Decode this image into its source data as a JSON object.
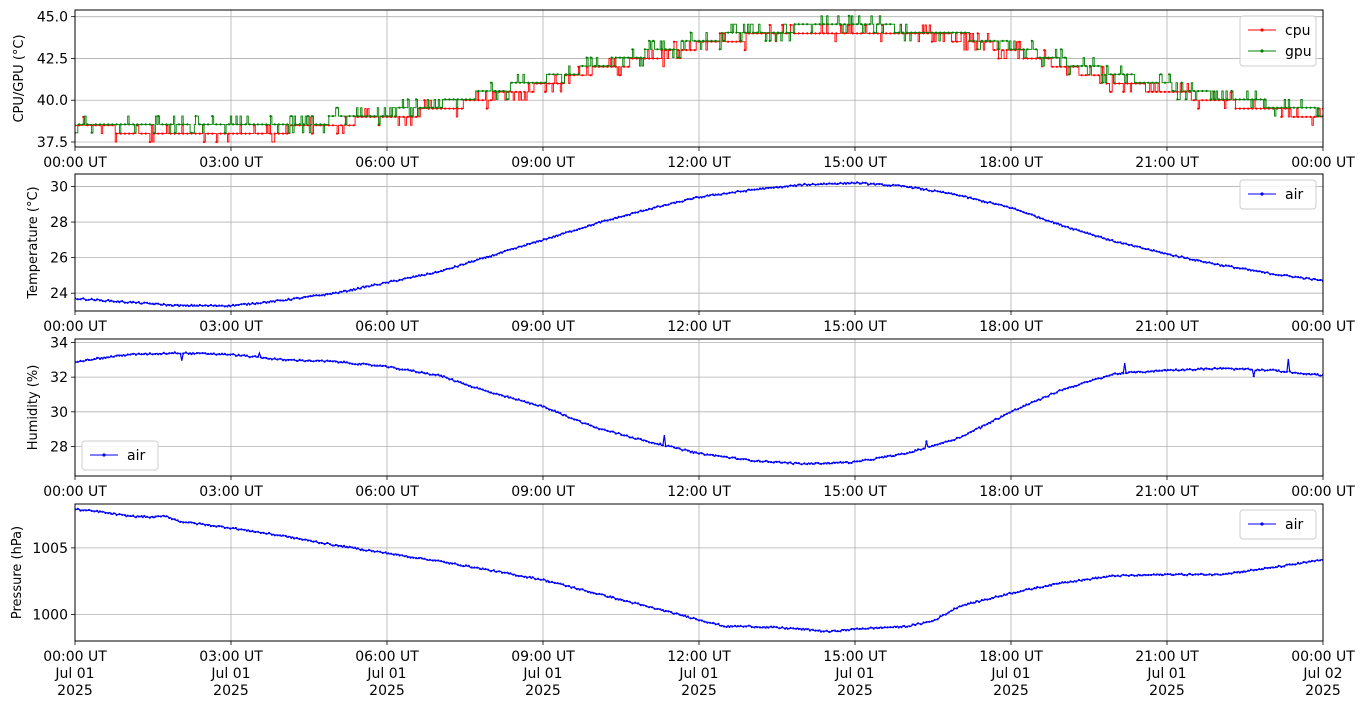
{
  "chart_data": [
    {
      "type": "line",
      "ylabel": "CPU/GPU (°C)",
      "xlim": [
        "00:00",
        "24:00"
      ],
      "ylim": [
        37.2,
        45.4
      ],
      "yticks": [
        "37.5",
        "40.0",
        "42.5",
        "45.0"
      ],
      "ytick_values": [
        37.5,
        40.0,
        42.5,
        45.0
      ],
      "xtick_labels": [
        "00:00 UT",
        "03:00 UT",
        "06:00 UT",
        "09:00 UT",
        "12:00 UT",
        "15:00 UT",
        "18:00 UT",
        "21:00 UT",
        "00:00 UT"
      ],
      "grid": true,
      "legend_position": "top-right",
      "series": [
        {
          "name": "cpu",
          "color": "#ff0000",
          "x_hours": [
            0,
            1,
            2,
            3,
            4,
            5,
            6,
            7,
            8,
            9,
            10,
            11,
            12,
            13,
            14,
            15,
            16,
            17,
            18,
            19,
            20,
            21,
            22,
            23,
            24
          ],
          "values": [
            38.4,
            38.2,
            38.1,
            38.0,
            38.2,
            38.6,
            39.0,
            39.4,
            40.2,
            40.9,
            41.8,
            42.5,
            43.3,
            43.8,
            44.1,
            44.2,
            44.0,
            43.7,
            43.0,
            42.0,
            41.1,
            40.5,
            39.9,
            39.4,
            38.9
          ]
        },
        {
          "name": "gpu",
          "color": "#008000",
          "x_hours": [
            0,
            1,
            2,
            3,
            4,
            5,
            6,
            7,
            8,
            9,
            10,
            11,
            12,
            13,
            14,
            15,
            16,
            17,
            18,
            19,
            20,
            21,
            22,
            23,
            24
          ],
          "values": [
            38.6,
            38.5,
            38.5,
            38.3,
            38.5,
            38.8,
            39.2,
            39.7,
            40.5,
            41.2,
            42.0,
            42.8,
            43.5,
            44.0,
            44.3,
            44.4,
            44.2,
            43.9,
            43.2,
            42.3,
            41.5,
            40.8,
            40.2,
            39.7,
            39.2
          ]
        }
      ]
    },
    {
      "type": "line",
      "ylabel": "Temperature (°C)",
      "xlim": [
        "00:00",
        "24:00"
      ],
      "ylim": [
        23.0,
        30.7
      ],
      "yticks": [
        "24",
        "26",
        "28",
        "30"
      ],
      "ytick_values": [
        24,
        26,
        28,
        30
      ],
      "xtick_labels": [
        "00:00 UT",
        "03:00 UT",
        "06:00 UT",
        "09:00 UT",
        "12:00 UT",
        "15:00 UT",
        "18:00 UT",
        "21:00 UT",
        "00:00 UT"
      ],
      "grid": true,
      "legend_position": "top-right",
      "series": [
        {
          "name": "air",
          "color": "#0000ff",
          "x_hours": [
            0,
            1,
            2,
            3,
            4,
            5,
            6,
            7,
            8,
            9,
            10,
            11,
            12,
            13,
            14,
            15,
            16,
            17,
            18,
            19,
            20,
            21,
            22,
            23,
            24
          ],
          "values": [
            23.7,
            23.5,
            23.3,
            23.3,
            23.6,
            24.0,
            24.6,
            25.2,
            26.1,
            27.0,
            27.9,
            28.7,
            29.4,
            29.8,
            30.1,
            30.2,
            30.0,
            29.5,
            28.8,
            27.8,
            26.9,
            26.2,
            25.6,
            25.1,
            24.7
          ]
        }
      ]
    },
    {
      "type": "line",
      "ylabel": "Humidity (%)",
      "xlim": [
        "00:00",
        "24:00"
      ],
      "ylim": [
        26.3,
        34.2
      ],
      "yticks": [
        "28",
        "30",
        "32",
        "34"
      ],
      "ytick_values": [
        28,
        30,
        32,
        34
      ],
      "xtick_labels": [
        "00:00 UT",
        "03:00 UT",
        "06:00 UT",
        "09:00 UT",
        "12:00 UT",
        "15:00 UT",
        "18:00 UT",
        "21:00 UT",
        "00:00 UT"
      ],
      "grid": true,
      "legend_position": "bottom-left",
      "series": [
        {
          "name": "air",
          "color": "#0000ff",
          "x_hours": [
            0,
            1,
            2,
            3,
            4,
            5,
            6,
            7,
            8,
            9,
            10,
            11,
            12,
            13,
            14,
            15,
            16,
            17,
            18,
            19,
            20,
            21,
            22,
            23,
            24
          ],
          "values": [
            32.9,
            33.3,
            33.4,
            33.3,
            33.0,
            32.9,
            32.6,
            32.1,
            31.1,
            30.3,
            29.1,
            28.3,
            27.6,
            27.2,
            27.0,
            27.1,
            27.6,
            28.5,
            30.0,
            31.3,
            32.2,
            32.4,
            32.5,
            32.4,
            32.1
          ]
        }
      ]
    },
    {
      "type": "line",
      "ylabel": "Pressure (hPa)",
      "xlim": [
        "00:00",
        "24:00"
      ],
      "ylim": [
        998.0,
        1008.3
      ],
      "yticks": [
        "1000",
        "1005"
      ],
      "ytick_values": [
        1000,
        1005
      ],
      "xtick_labels": [
        "00:00 UT",
        "03:00 UT",
        "06:00 UT",
        "09:00 UT",
        "12:00 UT",
        "15:00 UT",
        "18:00 UT",
        "21:00 UT",
        "00:00 UT"
      ],
      "xtick_dates": [
        "Jul 01",
        "Jul 01",
        "Jul 01",
        "Jul 01",
        "Jul 01",
        "Jul 01",
        "Jul 01",
        "Jul 01",
        "Jul 02"
      ],
      "xtick_years": [
        "2025",
        "2025",
        "2025",
        "2025",
        "2025",
        "2025",
        "2025",
        "2025",
        "2025"
      ],
      "grid": true,
      "legend_position": "top-right",
      "series": [
        {
          "name": "air",
          "color": "#0000ff",
          "x_hours": [
            0,
            0.5,
            1,
            1.5,
            1.75,
            2,
            3,
            4,
            5,
            6,
            7,
            8,
            9,
            10,
            11,
            12,
            12.5,
            13,
            14,
            14.5,
            15,
            16,
            16.5,
            17,
            18,
            19,
            20,
            21,
            22,
            23,
            24
          ],
          "values": [
            1007.9,
            1007.7,
            1007.4,
            1007.3,
            1007.4,
            1007.0,
            1006.5,
            1005.9,
            1005.2,
            1004.6,
            1004.0,
            1003.3,
            1002.6,
            1001.6,
            1000.6,
            999.6,
            999.1,
            999.1,
            998.9,
            998.7,
            998.9,
            999.1,
            999.5,
            1000.6,
            1001.6,
            1002.4,
            1002.9,
            1003.0,
            1003.0,
            1003.5,
            1004.1
          ]
        }
      ]
    }
  ]
}
